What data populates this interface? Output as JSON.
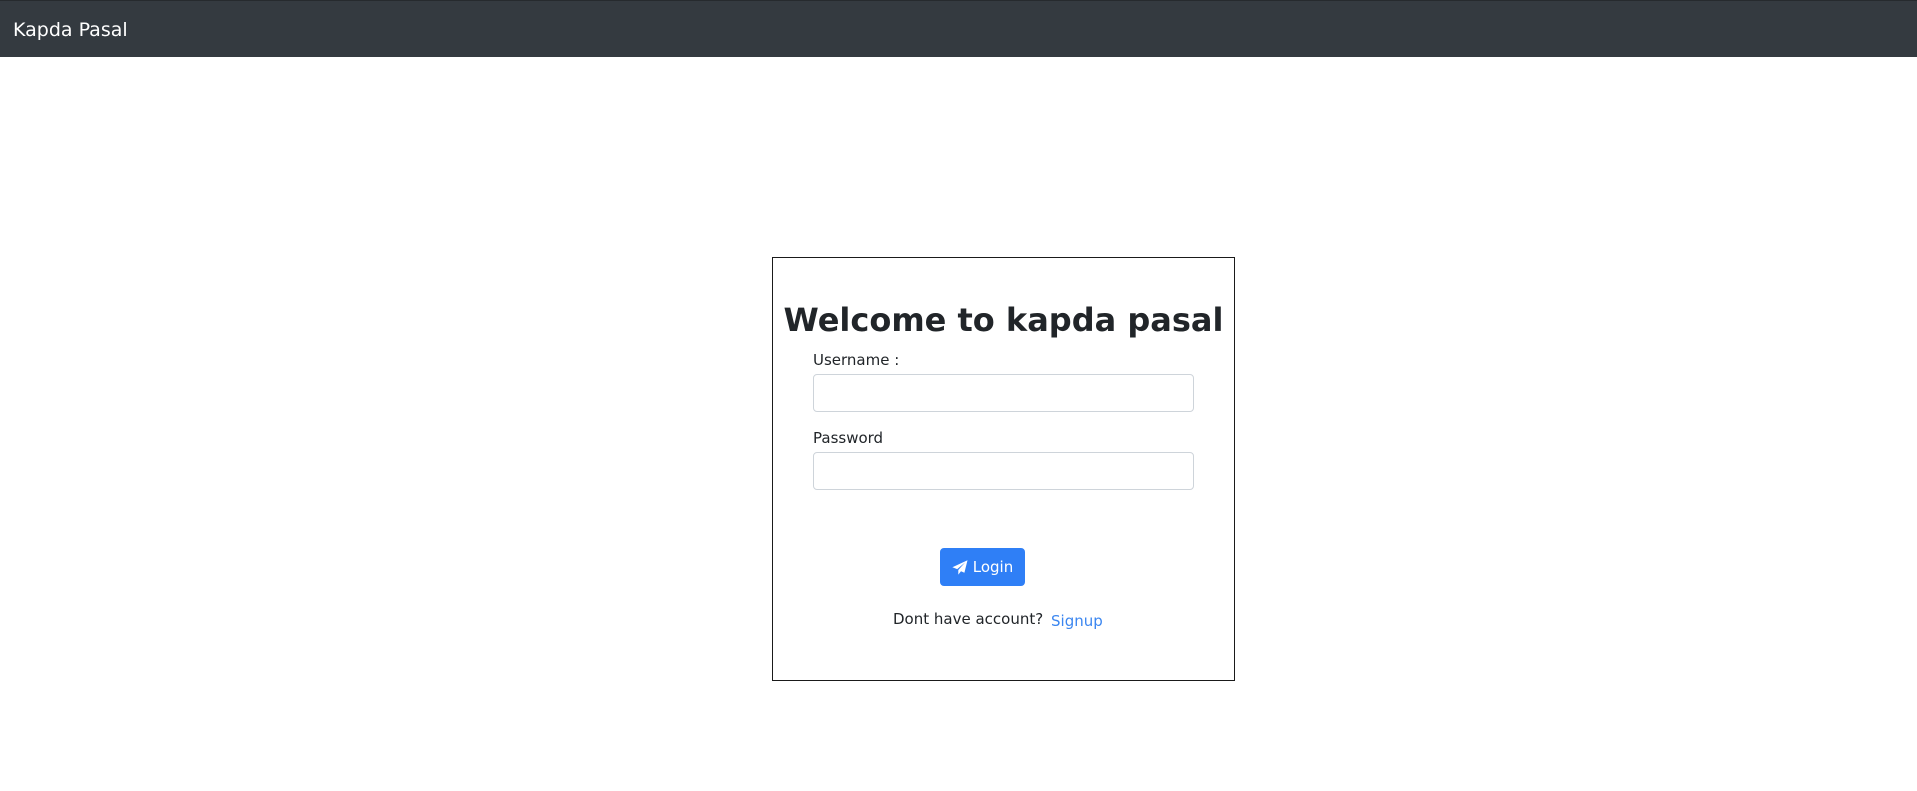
{
  "navbar": {
    "brand": "Kapda Pasal",
    "background_color": "#343a40"
  },
  "login_form": {
    "title": "Welcome to kapda pasal",
    "username_label": "Username :",
    "username_value": "",
    "password_label": "Password",
    "password_value": "",
    "login_button_label": "Login",
    "login_button_icon": "paper-plane-icon",
    "login_button_color": "#2f7ff6",
    "no_account_text": "Dont have account?",
    "signup_link_label": "Signup",
    "signup_link_color": "#3b86f0"
  }
}
